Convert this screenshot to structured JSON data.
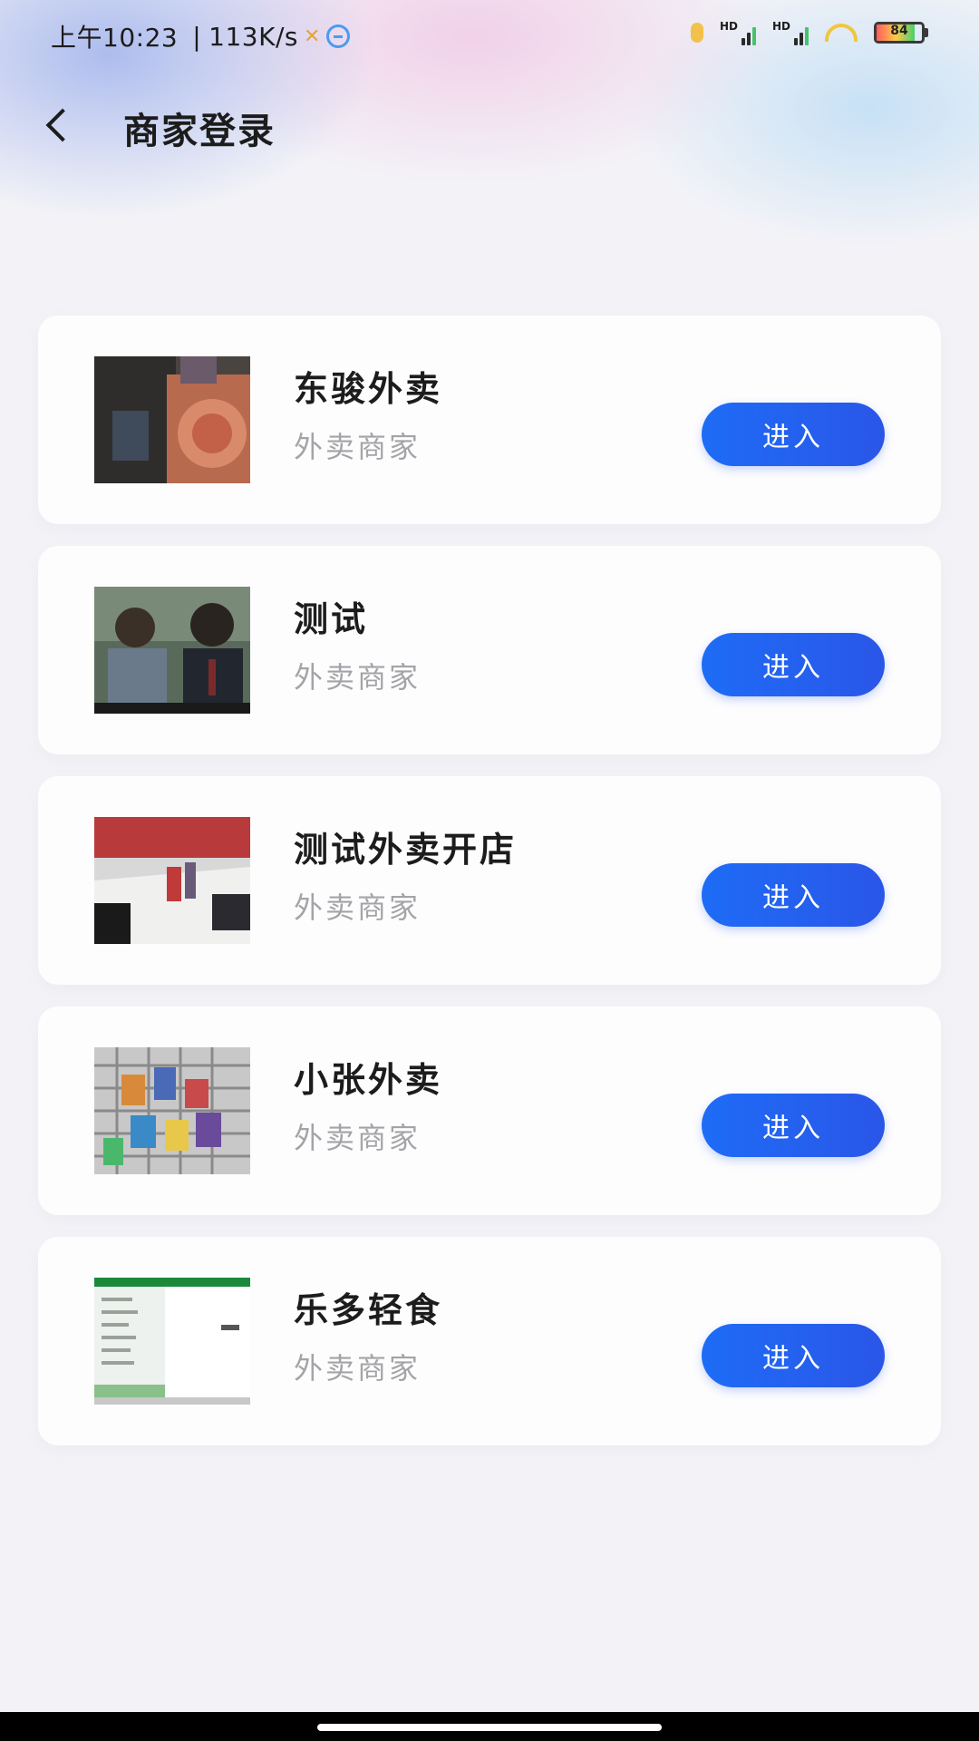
{
  "status_bar": {
    "time": "上午10:23",
    "separator": "|",
    "network_speed": "113K/s",
    "battery_level": "84",
    "battery_fraction": 0.84,
    "signal_label_1": "HD",
    "signal_label_2": "HD",
    "icons": [
      "alarm-icon",
      "signal-icon",
      "signal-icon",
      "wifi-icon",
      "battery-icon"
    ]
  },
  "header": {
    "title": "商家登录",
    "back_icon": "chevron-left-icon"
  },
  "merchants": [
    {
      "name": "东骏外卖",
      "type": "外卖商家",
      "button": "进入",
      "thumb": "thumb-1"
    },
    {
      "name": "测试",
      "type": "外卖商家",
      "button": "进入",
      "thumb": "thumb-2"
    },
    {
      "name": "测试外卖开店",
      "type": "外卖商家",
      "button": "进入",
      "thumb": "thumb-3"
    },
    {
      "name": "小张外卖",
      "type": "外卖商家",
      "button": "进入",
      "thumb": "thumb-4"
    },
    {
      "name": "乐多轻食",
      "type": "外卖商家",
      "button": "进入",
      "thumb": "thumb-5"
    }
  ],
  "colors": {
    "accent": "#1e6cf6",
    "title_text": "#1c1c1c",
    "sub_text": "#a4a4a8",
    "background": "#f3f3f7"
  }
}
